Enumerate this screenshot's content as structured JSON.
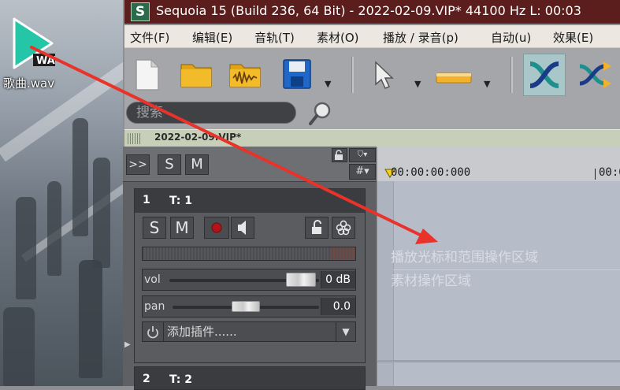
{
  "desktop": {
    "file_icon_badge": "WAV",
    "file_icon_label": "歌曲.wav"
  },
  "window": {
    "app_logo": "S",
    "title": "Sequoia 15 (Build 236, 64 Bit)  -  2022-02-09.VIP*   44100 Hz L: 00:03"
  },
  "menu": [
    "文件(F)",
    "编辑(E)",
    "音轨(T)",
    "素材(O)",
    "播放 / 录音(p)",
    "自动(u)",
    "效果(E)"
  ],
  "toolbar": {
    "icons": [
      "new-document-icon",
      "open-folder-icon",
      "audio-folder-icon",
      "save-icon",
      "pointer-tool-icon",
      "range-tool-icon",
      "crossfade-icon",
      "crossfade-alt-icon"
    ]
  },
  "search": {
    "placeholder": "搜索"
  },
  "project_tab": {
    "title": "2022-02-09.VIP*"
  },
  "track_header": {
    "expand_label": ">>",
    "solo_label": "S",
    "mute_label": "M"
  },
  "timeline": {
    "start_timecode": "00:00:00:000",
    "next_timecode": "00:0",
    "hint_playback": "播放光标和范围操作区域",
    "hint_material": "素材操作区域"
  },
  "tracks": [
    {
      "number": "1",
      "name": "T: 1",
      "solo_label": "S",
      "mute_label": "M",
      "volume_label": "vol",
      "volume_value": "0 dB",
      "volume_level": 0.88,
      "pan_label": "pan",
      "pan_value": "0.0",
      "pan_level": 0.5,
      "plugin_label": "添加插件......"
    },
    {
      "number": "2",
      "name": "T: 2"
    }
  ],
  "colors": {
    "titlebar": "#5b1e1c",
    "accent_green": "#2b6a4a",
    "annotation_arrow": "#e8322a"
  }
}
